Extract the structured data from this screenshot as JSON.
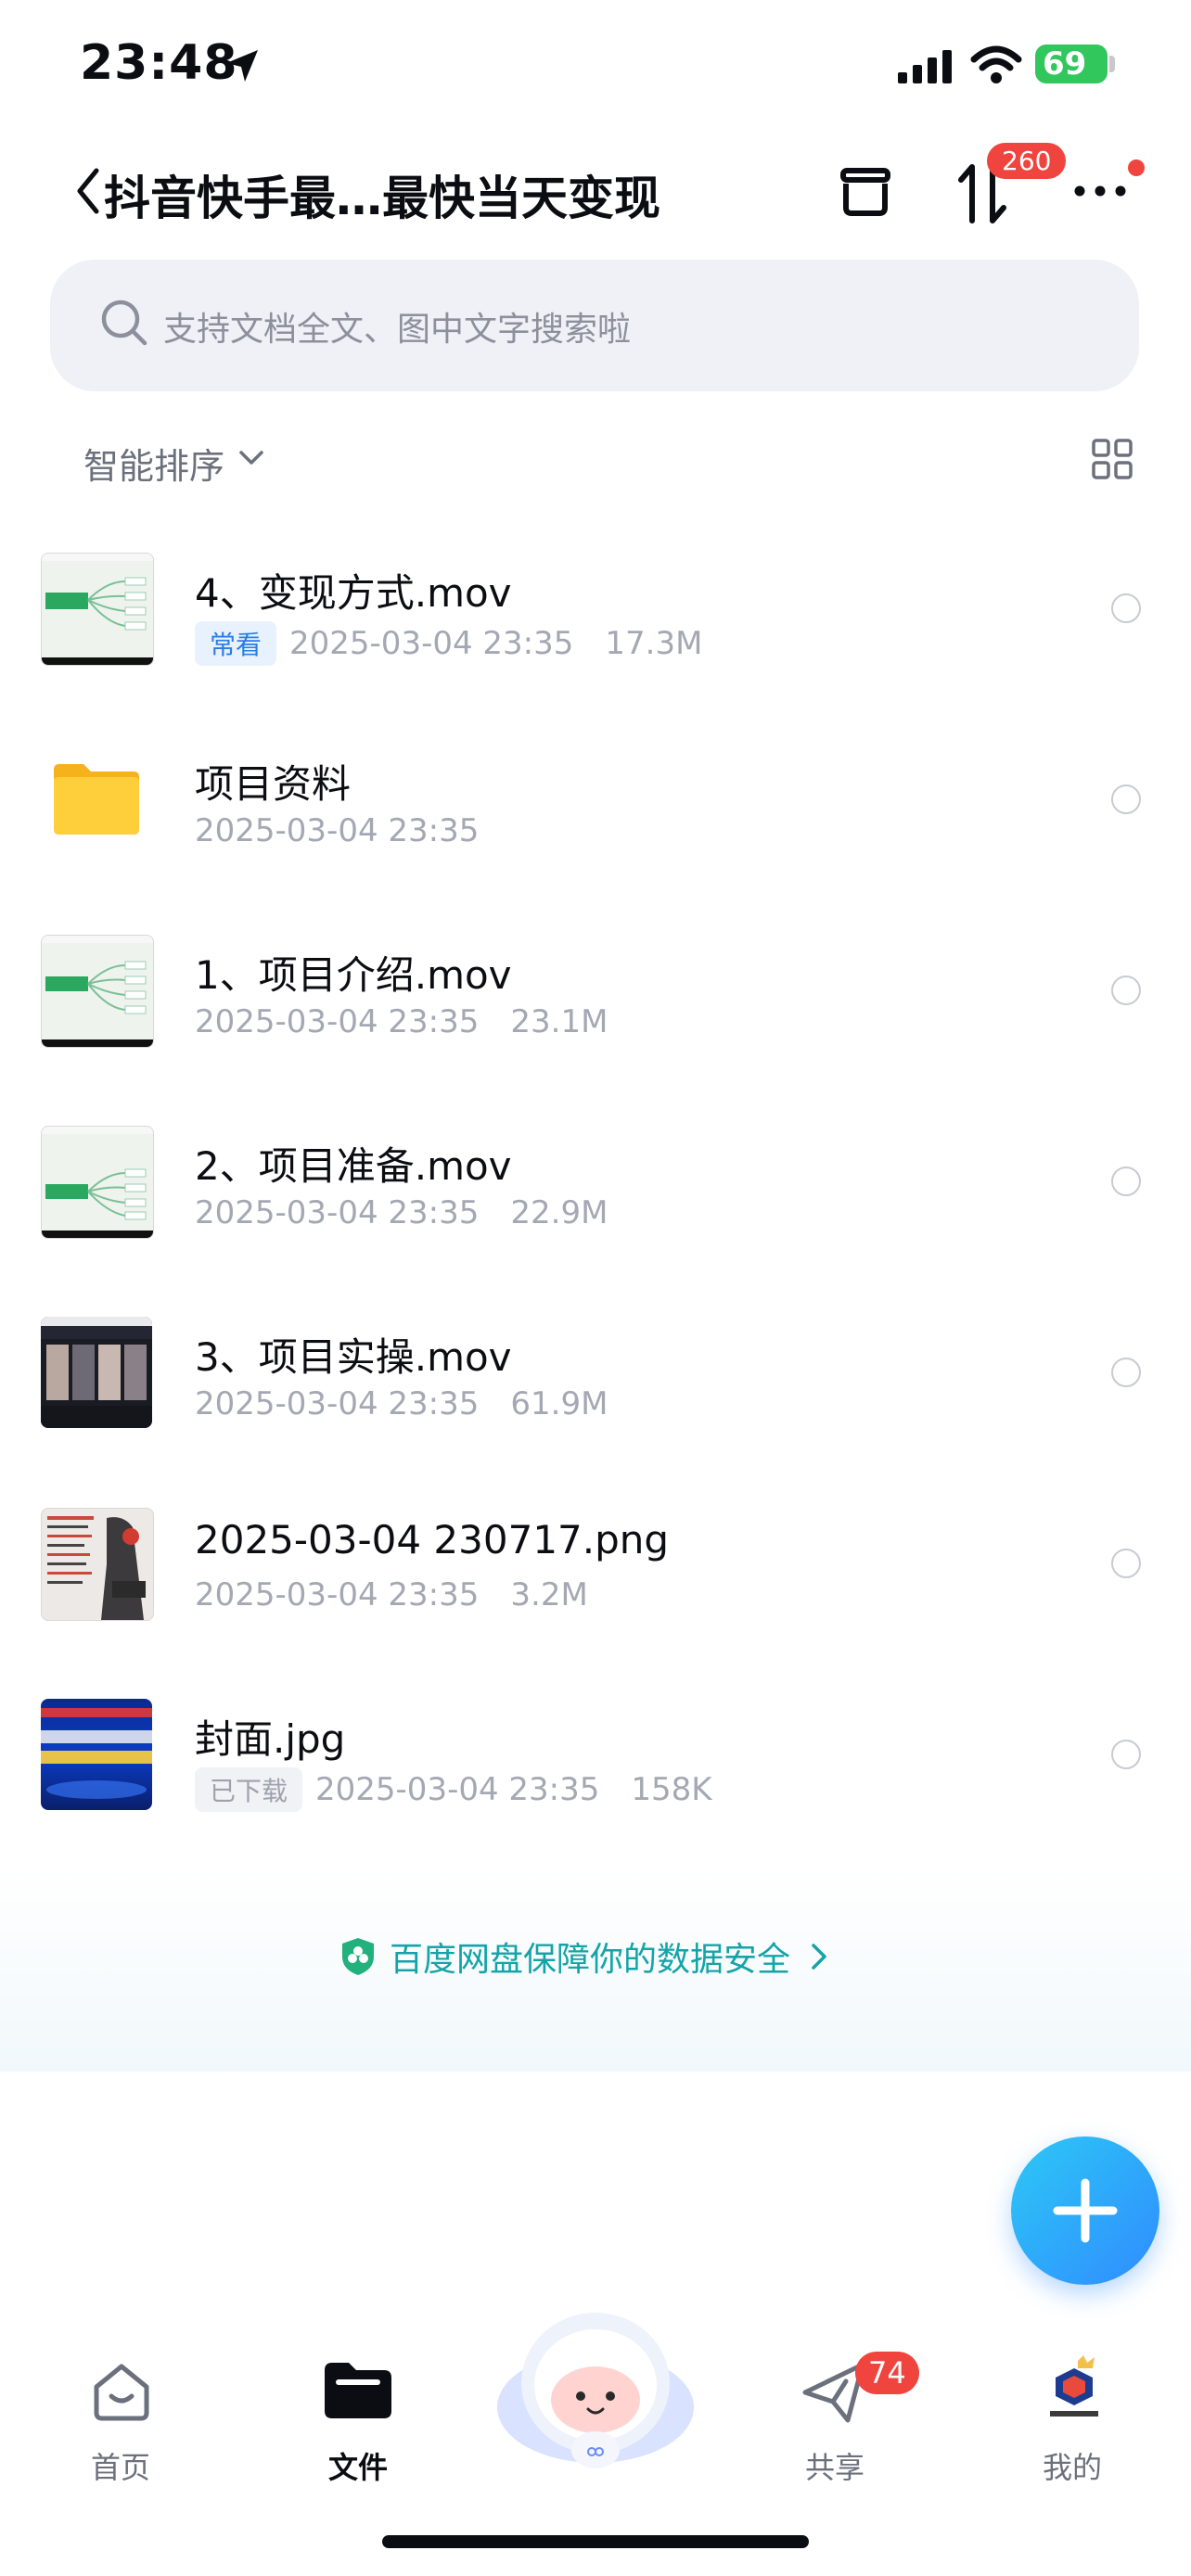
{
  "status_bar": {
    "time": "23:48",
    "battery": "69"
  },
  "nav": {
    "title": "抖音快手最…最快当天变现",
    "transfer_badge": "260"
  },
  "search": {
    "placeholder": "支持文档全文、图中文字搜索啦"
  },
  "sort": {
    "label": "智能排序"
  },
  "files": [
    {
      "name": "4、变现方式.mov",
      "tag": "常看",
      "tag_style": "blue",
      "date": "2025-03-04 23:35",
      "size": "17.3M",
      "thumb": "video-mindmap"
    },
    {
      "name": "项目资料",
      "tag": "",
      "date": "2025-03-04 23:35",
      "size": "",
      "thumb": "folder"
    },
    {
      "name": "1、项目介绍.mov",
      "tag": "",
      "date": "2025-03-04 23:35",
      "size": "23.1M",
      "thumb": "video-mindmap"
    },
    {
      "name": "2、项目准备.mov",
      "tag": "",
      "date": "2025-03-04 23:35",
      "size": "22.9M",
      "thumb": "video-mindmap"
    },
    {
      "name": "3、项目实操.mov",
      "tag": "",
      "date": "2025-03-04 23:35",
      "size": "61.9M",
      "thumb": "video-dark"
    },
    {
      "name": "2025-03-04 230717.png",
      "tag": "",
      "date": "2025-03-04 23:35",
      "size": "3.2M",
      "thumb": "image-poster"
    },
    {
      "name": "封面.jpg",
      "tag": "已下载",
      "tag_style": "grey",
      "date": "2025-03-04 23:35",
      "size": "158K",
      "thumb": "image-cover"
    }
  ],
  "safety_banner": {
    "text": "百度网盘保障你的数据安全"
  },
  "tabbar": {
    "items": [
      {
        "label": "首页",
        "icon": "home-icon",
        "active": false
      },
      {
        "label": "文件",
        "icon": "folder-icon",
        "active": true
      },
      {
        "label": "",
        "icon": "mascot-icon",
        "active": false
      },
      {
        "label": "共享",
        "icon": "share-icon",
        "active": false,
        "badge": "74"
      },
      {
        "label": "我的",
        "icon": "profile-icon",
        "active": false
      }
    ]
  },
  "colors": {
    "accent": "#2f8cff",
    "badge": "#f0453f",
    "battery": "#31c75d",
    "safety_text": "#14a4a8"
  }
}
